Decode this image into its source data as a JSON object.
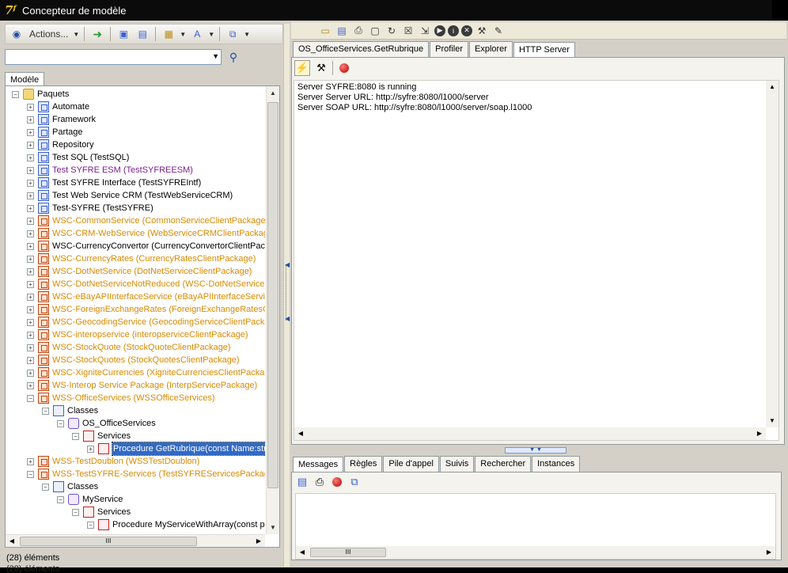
{
  "window": {
    "title": "Concepteur de modèle"
  },
  "left_toolbar": {
    "actions_label": "Actions..."
  },
  "left_tabs": [
    "Modèle"
  ],
  "tree": [
    {
      "label": "Paquets",
      "depth": 0,
      "expander": "⊟",
      "icon": "folder",
      "color": "black"
    },
    {
      "label": "Automate",
      "depth": 1,
      "expander": "⊞",
      "icon": "pkg-blue",
      "color": "black"
    },
    {
      "label": "Framework",
      "depth": 1,
      "expander": "⊞",
      "icon": "pkg-blue",
      "color": "black"
    },
    {
      "label": "Partage",
      "depth": 1,
      "expander": "⊞",
      "icon": "pkg-blue",
      "color": "black"
    },
    {
      "label": "Repository",
      "depth": 1,
      "expander": "⊞",
      "icon": "pkg-blue",
      "color": "black"
    },
    {
      "label": "Test SQL (TestSQL)",
      "depth": 1,
      "expander": "⊞",
      "icon": "pkg-blue",
      "color": "black"
    },
    {
      "label": "Test SYFRE ESM (TestSYFREESM)",
      "depth": 1,
      "expander": "⊞",
      "icon": "pkg-blue",
      "color": "purple"
    },
    {
      "label": "Test SYFRE Interface (TestSYFREIntf)",
      "depth": 1,
      "expander": "⊞",
      "icon": "pkg-blue",
      "color": "black"
    },
    {
      "label": "Test Web Service CRM (TestWebServiceCRM)",
      "depth": 1,
      "expander": "⊞",
      "icon": "pkg-blue",
      "color": "black"
    },
    {
      "label": "Test-SYFRE (TestSYFRE)",
      "depth": 1,
      "expander": "⊞",
      "icon": "pkg-blue",
      "color": "black"
    },
    {
      "label": "WSC-CommonService (CommonServiceClientPackage)",
      "depth": 1,
      "expander": "⊞",
      "icon": "pkg-orange",
      "color": "orange"
    },
    {
      "label": "WSC-CRM-WebService (WebServiceCRMClientPackage)",
      "depth": 1,
      "expander": "⊞",
      "icon": "pkg-orange",
      "color": "orange"
    },
    {
      "label": "WSC-CurrencyConvertor (CurrencyConvertorClientPackage)",
      "depth": 1,
      "expander": "⊞",
      "icon": "pkg-orange",
      "color": "black"
    },
    {
      "label": "WSC-CurrencyRates (CurrencyRatesClientPackage)",
      "depth": 1,
      "expander": "⊞",
      "icon": "pkg-orange",
      "color": "orange"
    },
    {
      "label": "WSC-DotNetService (DotNetServiceClientPackage)",
      "depth": 1,
      "expander": "⊞",
      "icon": "pkg-orange",
      "color": "orange"
    },
    {
      "label": "WSC-DotNetServiceNotReduced (WSC-DotNetServiceNotReduced)",
      "depth": 1,
      "expander": "⊞",
      "icon": "pkg-orange",
      "color": "orange"
    },
    {
      "label": "WSC-eBayAPIInterfaceService (eBayAPIInterfaceServiceClientPackage)",
      "depth": 1,
      "expander": "⊞",
      "icon": "pkg-orange",
      "color": "orange"
    },
    {
      "label": "WSC-ForeignExchangeRates (ForeignExchangeRatesClientPackage)",
      "depth": 1,
      "expander": "⊞",
      "icon": "pkg-orange",
      "color": "orange"
    },
    {
      "label": "WSC-GeocodingService (GeocodingServiceClientPackage)",
      "depth": 1,
      "expander": "⊞",
      "icon": "pkg-orange",
      "color": "orange"
    },
    {
      "label": "WSC-interopservice (interopserviceClientPackage)",
      "depth": 1,
      "expander": "⊞",
      "icon": "pkg-orange",
      "color": "orange"
    },
    {
      "label": "WSC-StockQuote (StockQuoteClientPackage)",
      "depth": 1,
      "expander": "⊞",
      "icon": "pkg-orange",
      "color": "orange"
    },
    {
      "label": "WSC-StockQuotes (StockQuotesClientPackage)",
      "depth": 1,
      "expander": "⊞",
      "icon": "pkg-orange",
      "color": "orange"
    },
    {
      "label": "WSC-XigniteCurrencies (XigniteCurrenciesClientPackage)",
      "depth": 1,
      "expander": "⊞",
      "icon": "pkg-orange",
      "color": "orange"
    },
    {
      "label": "WS-Interop Service Package (InterpServicePackage)",
      "depth": 1,
      "expander": "⊞",
      "icon": "pkg-orange",
      "color": "orange"
    },
    {
      "label": "WSS-OfficeServices (WSSOfficeServices)",
      "depth": 1,
      "expander": "⊟",
      "icon": "pkg-orange",
      "color": "orange"
    },
    {
      "label": "Classes",
      "depth": 2,
      "expander": "⊟",
      "icon": "cls",
      "color": "black"
    },
    {
      "label": "OS_OfficeServices",
      "depth": 3,
      "expander": "⊟",
      "icon": "svc",
      "color": "black"
    },
    {
      "label": "Services",
      "depth": 4,
      "expander": "⊟",
      "icon": "proc",
      "color": "black"
    },
    {
      "label": "Procedure GetRubrique(const Name:string)",
      "depth": 5,
      "expander": "⊞",
      "icon": "proc",
      "color": "black",
      "selected": true
    },
    {
      "label": "WSS-TestDoublon (WSSTestDoublon)",
      "depth": 1,
      "expander": "⊞",
      "icon": "pkg-orange",
      "color": "orange"
    },
    {
      "label": "WSS-TestSYFRE-Services (TestSYFREServicesPackage)",
      "depth": 1,
      "expander": "⊟",
      "icon": "pkg-orange",
      "color": "orange"
    },
    {
      "label": "Classes",
      "depth": 2,
      "expander": "⊟",
      "icon": "cls",
      "color": "black"
    },
    {
      "label": "MyService",
      "depth": 3,
      "expander": "⊟",
      "icon": "svc",
      "color": "black"
    },
    {
      "label": "Services",
      "depth": 4,
      "expander": "⊟",
      "icon": "proc",
      "color": "black"
    },
    {
      "label": "Procedure MyServiceWithArray(const p",
      "depth": 5,
      "expander": "⊟",
      "icon": "proc",
      "color": "black"
    }
  ],
  "status": {
    "count_text": "(28) éléments",
    "count_text_2": "(28) éléments"
  },
  "doc_tabs": [
    "OS_OfficeServices.GetRubrique",
    "Profiler",
    "Explorer",
    "HTTP Server"
  ],
  "doc_active_tab": "HTTP Server",
  "log_lines": [
    "Server SYFRE:8080 is running",
    "Server Server URL: http://syfre:8080/l1000/server",
    "Server SOAP URL: http://syfre:8080/l1000/server/soap.l1000"
  ],
  "msg_tabs": [
    "Messages",
    "Règles",
    "Pile d'appel",
    "Suivis",
    "Rechercher",
    "Instances"
  ],
  "msg_active_tab": "Messages",
  "scroll_labels": {
    "grip": "III"
  }
}
